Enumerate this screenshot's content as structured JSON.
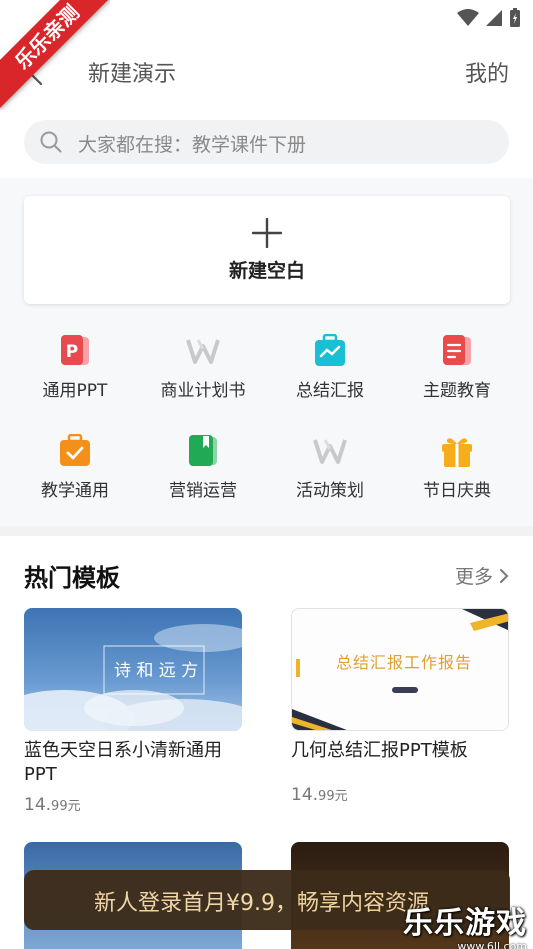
{
  "ribbon": {
    "text": "乐乐亲测"
  },
  "header": {
    "title": "新建演示",
    "mine_label": "我的"
  },
  "search": {
    "placeholder": "大家都在搜：教学课件下册"
  },
  "new_blank": {
    "label": "新建空白"
  },
  "categories": [
    {
      "label": "通用PPT",
      "icon": "ppt-icon",
      "color": "#e84a4f"
    },
    {
      "label": "商业计划书",
      "icon": "w-logo-icon",
      "color": "#c9c9c9"
    },
    {
      "label": "总结汇报",
      "icon": "chart-briefcase-icon",
      "color": "#1bbfd3"
    },
    {
      "label": "主题教育",
      "icon": "document-icon",
      "color": "#ea4a4a"
    },
    {
      "label": "教学通用",
      "icon": "check-briefcase-icon",
      "color": "#f39019"
    },
    {
      "label": "营销运营",
      "icon": "book-icon",
      "color": "#21a956"
    },
    {
      "label": "活动策划",
      "icon": "w-logo-icon",
      "color": "#c9c9c9"
    },
    {
      "label": "节日庆典",
      "icon": "gift-icon",
      "color": "#f6ad1c"
    }
  ],
  "hot": {
    "title": "热门模板",
    "more_label": "更多"
  },
  "templates": [
    {
      "name": "蓝色天空日系小清新通用PPT",
      "price_main": "14.",
      "price_decimal": "99元",
      "thumb_text": "诗 和 远 方"
    },
    {
      "name": "几何总结汇报PPT模板",
      "price_main": "14.",
      "price_decimal": "99元",
      "thumb_text": "总结汇报工作报告"
    }
  ],
  "promo": {
    "text": "新人登录首月¥9.9，畅享内容资源"
  },
  "watermark": {
    "main": "乐乐游戏",
    "sub": "www.6ll.com"
  }
}
